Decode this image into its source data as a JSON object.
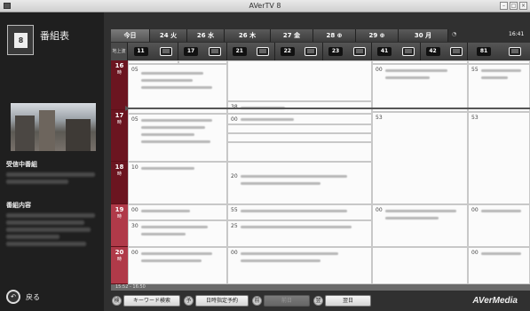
{
  "window": {
    "title": "AVerTV 8",
    "buttons": [
      "–",
      "□",
      "×"
    ]
  },
  "sidebar": {
    "heading": "番組表",
    "receiving_label": "受信中番組",
    "details_label": "番組内容",
    "back_label": "戻る"
  },
  "datebar": {
    "tabs": [
      {
        "label": "今日"
      },
      {
        "label": "24 火"
      },
      {
        "label": "26 水"
      },
      {
        "label": "26 木"
      },
      {
        "label": "27 金"
      },
      {
        "label": "28 ⊕"
      },
      {
        "label": "29 ⊕"
      },
      {
        "label": "30 月"
      }
    ],
    "clock_icon": "clock-icon",
    "clock_time": "16:41"
  },
  "channels": {
    "corner_label": "地上波",
    "items": [
      "11",
      "17",
      "21",
      "22",
      "23",
      "41",
      "42",
      "81"
    ]
  },
  "timeline": {
    "hours": [
      {
        "hour": "16",
        "unit": "時"
      },
      {
        "hour": "17",
        "unit": "時"
      },
      {
        "hour": "18",
        "unit": "時"
      },
      {
        "hour": "19",
        "unit": "時"
      },
      {
        "hour": "20",
        "unit": "時"
      }
    ]
  },
  "program_minutes": [
    "05",
    "38",
    "00",
    "00",
    "55",
    "05",
    "00",
    "53",
    "53",
    "10",
    "20",
    "00",
    "55",
    "00",
    "30",
    "25",
    "00",
    "00",
    "00",
    "00"
  ],
  "status_bar": {
    "time_range": "15:52 - 16:50"
  },
  "bottom": {
    "keyword_search": "キーワード検索",
    "date_reservation": "日時指定予約",
    "prev_day": "前日",
    "next_day": "翌日",
    "brand": "AVerMedia"
  }
}
